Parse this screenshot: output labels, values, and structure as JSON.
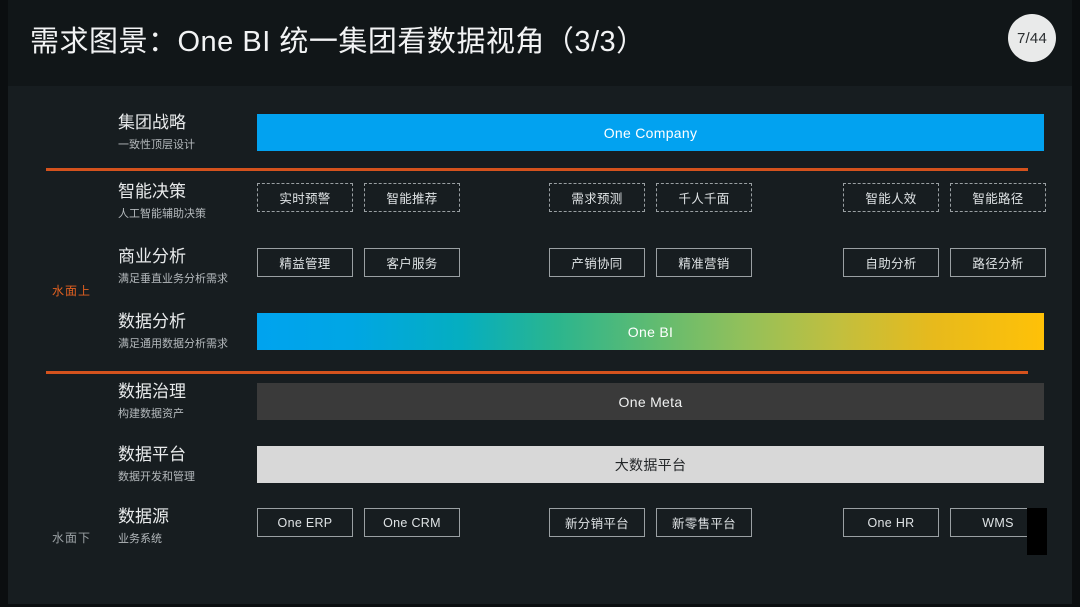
{
  "header": {
    "title": "需求图景：One BI 统一集团看数据视角（3/3）",
    "page_badge": "7/44"
  },
  "side_labels": {
    "above_water": "水面上",
    "below_water": "水面下"
  },
  "colors": {
    "slide_background": "#141a1d",
    "canvas_background": "#171d20",
    "divider_orange": "#d4521d",
    "above_water_label": "#e06020",
    "below_water_label": "#9aa0a3",
    "bar_blue": "#02a2f0",
    "bar_dark_gray": "#3a3a3a",
    "bar_light_gray": "#d8d8d8",
    "chip_border": "#9aa0a3",
    "gradient_start": "#00a3ef",
    "gradient_mid": "#5ebb72",
    "gradient_end": "#ffc107"
  },
  "rows": [
    {
      "key": "group_strategy",
      "title": "集团战略",
      "subtitle": "一致性顶层设计",
      "type": "bar",
      "bar_style": "blue",
      "bar_label": "One Company"
    },
    {
      "key": "smart_decision",
      "title": "智能决策",
      "subtitle": "人工智能辅助决策",
      "type": "chips",
      "chip_style": "dashed",
      "groups": [
        [
          "实时预警",
          "智能推荐"
        ],
        [
          "需求预测",
          "千人千面"
        ],
        [
          "智能人效",
          "智能路径"
        ]
      ]
    },
    {
      "key": "business_analysis",
      "title": "商业分析",
      "subtitle": "满足垂直业务分析需求",
      "type": "chips",
      "chip_style": "solid",
      "groups": [
        [
          "精益管理",
          "客户服务"
        ],
        [
          "产销协同",
          "精准营销"
        ],
        [
          "自助分析",
          "路径分析"
        ]
      ]
    },
    {
      "key": "data_analysis",
      "title": "数据分析",
      "subtitle": "满足通用数据分析需求",
      "type": "bar",
      "bar_style": "gradient",
      "bar_label": "One BI"
    },
    {
      "key": "data_governance",
      "title": "数据治理",
      "subtitle": "构建数据资产",
      "type": "bar",
      "bar_style": "dark_gray",
      "bar_label": "One Meta"
    },
    {
      "key": "data_platform",
      "title": "数据平台",
      "subtitle": "数据开发和管理",
      "type": "bar",
      "bar_style": "light_gray",
      "bar_label": "大数据平台"
    },
    {
      "key": "data_source",
      "title": "数据源",
      "subtitle": "业务系统",
      "type": "chips",
      "chip_style": "solid",
      "groups": [
        [
          "One ERP",
          "One CRM"
        ],
        [
          "新分销平台",
          "新零售平台"
        ],
        [
          "One HR",
          "WMS"
        ]
      ]
    }
  ]
}
